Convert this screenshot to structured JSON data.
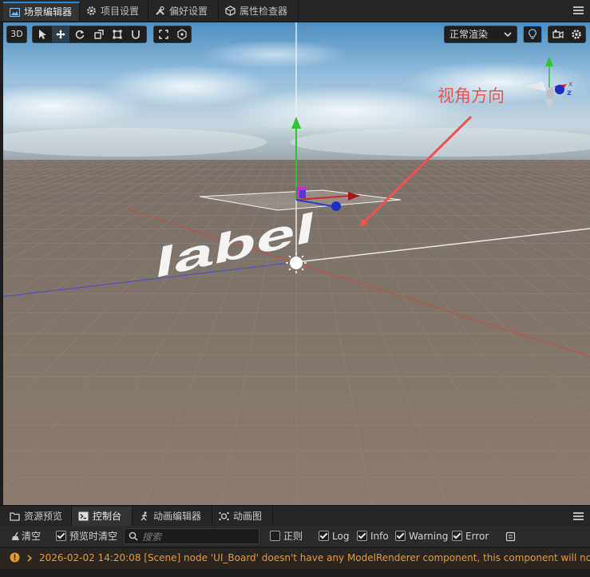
{
  "tabs": [
    {
      "label": "场景编辑器",
      "icon": "scene-icon",
      "active": true
    },
    {
      "label": "项目设置",
      "icon": "gear-icon"
    },
    {
      "label": "偏好设置",
      "icon": "tools-icon"
    },
    {
      "label": "属性检查器",
      "icon": "cube-icon"
    }
  ],
  "scene_toolbar": {
    "mode_3d": "3D",
    "render_mode": "正常渲染",
    "tools": [
      "select-tool-icon",
      "move-tool-icon",
      "rotate-tool-icon",
      "scale-tool-icon",
      "rect-tool-icon",
      "magnet-icon"
    ],
    "extra_tools": [
      "bounds-icon",
      "pivot-icon"
    ]
  },
  "scene": {
    "label_text": "label",
    "annotation": "视角方向",
    "gizmo_axes": {
      "x": "x",
      "z": "z"
    },
    "colors": {
      "x_axis": "#e03030",
      "y_axis": "#22c322",
      "z_axis": "#2040e0",
      "annotation": "#ef5350"
    }
  },
  "bottom_tabs": [
    {
      "label": "资源预览",
      "icon": "folder-icon"
    },
    {
      "label": "控制台",
      "icon": "terminal-icon",
      "active": true
    },
    {
      "label": "动画编辑器",
      "icon": "runner-icon"
    },
    {
      "label": "动画图",
      "icon": "anim-graph-icon"
    }
  ],
  "console": {
    "clear_label": "清空",
    "clear_on_preview_label": "预览时清空",
    "search_placeholder": "搜索",
    "regex_label": "正则",
    "filters": [
      "Log",
      "Info",
      "Warning",
      "Error"
    ],
    "message": "2026-02-02 14:20:08 [Scene] node 'UI_Board' doesn't have any ModelRenderer component, this component will not work. please"
  }
}
